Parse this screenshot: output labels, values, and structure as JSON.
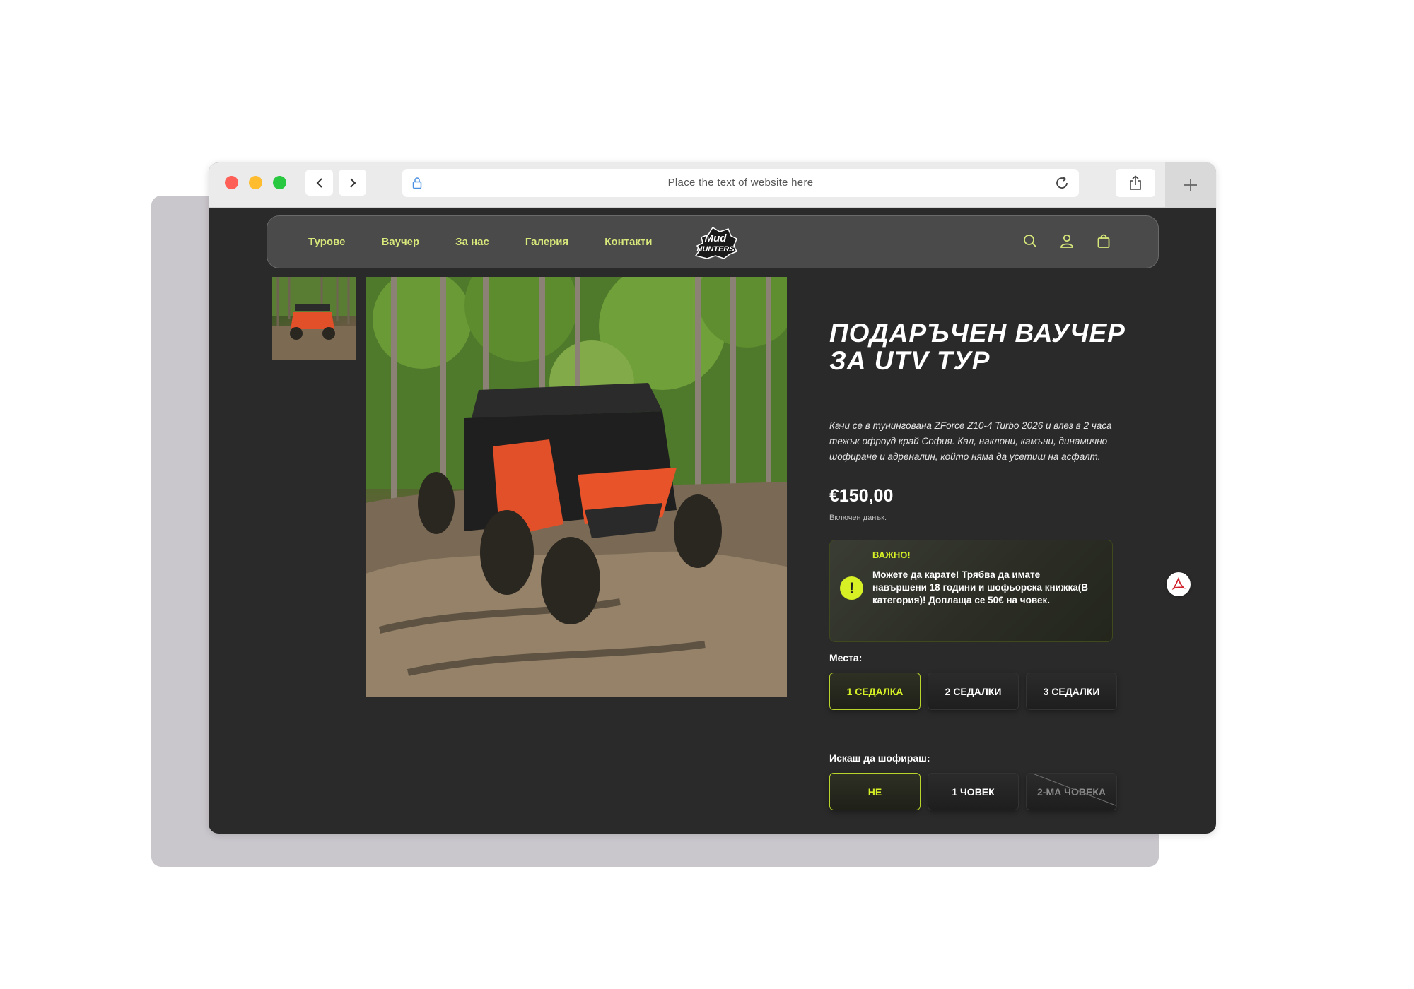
{
  "browser": {
    "url_placeholder": "Place the text of website here",
    "icons": [
      "chevron-left-icon",
      "chevron-right-icon",
      "lock-icon",
      "reload-icon",
      "share-icon",
      "plus-icon"
    ]
  },
  "site_nav": {
    "links": [
      "Турове",
      "Ваучер",
      "За нас",
      "Галерия",
      "Контакти"
    ],
    "logo_text": "Mud Hunters",
    "icons": [
      "search-icon",
      "user-icon",
      "bag-icon"
    ]
  },
  "product": {
    "title": "ПОДАРЪЧЕН ВАУЧЕР ЗА UTV ТУР",
    "description": "Качи се в тунингована ZForce Z10-4 Turbo 2026 и влез в 2 часа тежък офроуд край София. Кал, наклони, камъни, динамично шофиране и адреналин, който няма да усетиш на асфалт.",
    "price": "€150,00",
    "tax_note": "Включен данък.",
    "notice": {
      "title": "ВАЖНО!",
      "icon_glyph": "!",
      "body": "Можете да карате! Трябва да имате навършени 18 години и шофьорска книжка(В категория)! Доплаща се 50€ на човек."
    },
    "seats": {
      "label": "Места:",
      "options": [
        "1 седалка",
        "2 седалки",
        "3 седалки"
      ],
      "selected": "1 седалка"
    },
    "driving": {
      "label": "Искаш да шофираш:",
      "options": [
        "Не",
        "1 човек",
        "2-ма човека"
      ],
      "selected": "Не",
      "disabled": "2-ма човека"
    }
  },
  "colors": {
    "accent": "#d6f025",
    "nav_link": "#d9e87a",
    "page_bg": "#2a2a2a",
    "vehicle": "#e2502a"
  }
}
